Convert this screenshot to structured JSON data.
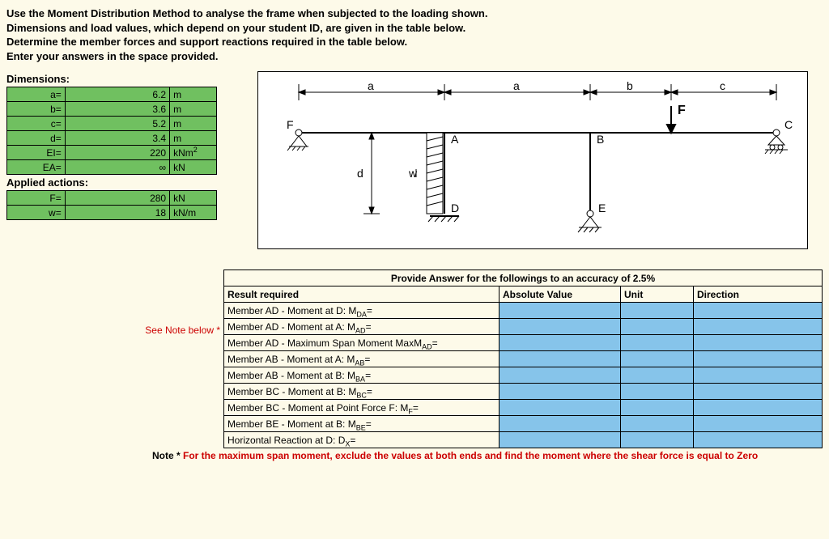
{
  "intro": [
    "Use the Moment Distribution Method to analyse the frame when subjected to the loading shown.",
    "Dimensions and load values, which depend on your student ID, are given in the table below.",
    "Determine the member forces and support reactions required in the table below.",
    "Enter your answers in the space provided."
  ],
  "headings": {
    "dimensions": "Dimensions:",
    "actions": "Applied actions:"
  },
  "dims": {
    "a": {
      "label": "a=",
      "value": "6.2",
      "unit": "m"
    },
    "b": {
      "label": "b=",
      "value": "3.6",
      "unit": "m"
    },
    "c": {
      "label": "c=",
      "value": "5.2",
      "unit": "m"
    },
    "d": {
      "label": "d=",
      "value": "3.4",
      "unit": "m"
    },
    "ei": {
      "label": "EI=",
      "value": "220",
      "unit_prefix": "kNm",
      "unit_sup": "2"
    },
    "ea": {
      "label": "EA=",
      "value": "∞",
      "unit": "kN"
    }
  },
  "actions": {
    "f": {
      "label": "F=",
      "value": "280",
      "unit": "kN"
    },
    "w": {
      "label": "w=",
      "value": "18",
      "unit": "kN/m"
    }
  },
  "diagram": {
    "dim_a": "a",
    "dim_b": "b",
    "dim_c": "c",
    "dim_d": "d",
    "force_label": "F",
    "node_F": "F",
    "node_A": "A",
    "node_B": "B",
    "node_C": "C",
    "node_D": "D",
    "node_E": "E",
    "w_label": "w"
  },
  "answers": {
    "title": "Provide Answer for the followings to an accuracy of 2.5%",
    "head_req": "Result required",
    "head_abs": "Absolute Value",
    "head_unit": "Unit",
    "head_dir": "Direction",
    "note_side": "See Note below *",
    "rows": [
      {
        "text_prefix": "Member AD - Moment at D:  M",
        "sub": "DA",
        "suffix": "="
      },
      {
        "text_prefix": "Member AD - Moment at A:  M",
        "sub": "AD",
        "suffix": "="
      },
      {
        "text_prefix": "Member AD -  Maximum Span Moment MaxM",
        "sub": "AD",
        "suffix": "="
      },
      {
        "text_prefix": "Member AB - Moment at A:  M",
        "sub": "AB",
        "suffix": "="
      },
      {
        "text_prefix": "Member AB - Moment at B:  M",
        "sub": "BA",
        "suffix": "="
      },
      {
        "text_prefix": "Member BC - Moment at B:  M",
        "sub": "BC",
        "suffix": "="
      },
      {
        "text_prefix": "Member BC - Moment at Point Force F: M",
        "sub": "F",
        "suffix": "="
      },
      {
        "text_prefix": "Member BE - Moment at B:  M",
        "sub": "BE",
        "suffix": "="
      },
      {
        "text_prefix": "Horizontal Reaction at D:  D",
        "sub": "X",
        "suffix": "="
      }
    ]
  },
  "footnote": {
    "lead": "Note *  ",
    "body": "For the maximum span moment, exclude the values at both ends and find the moment where the shear force is equal to Zero"
  }
}
